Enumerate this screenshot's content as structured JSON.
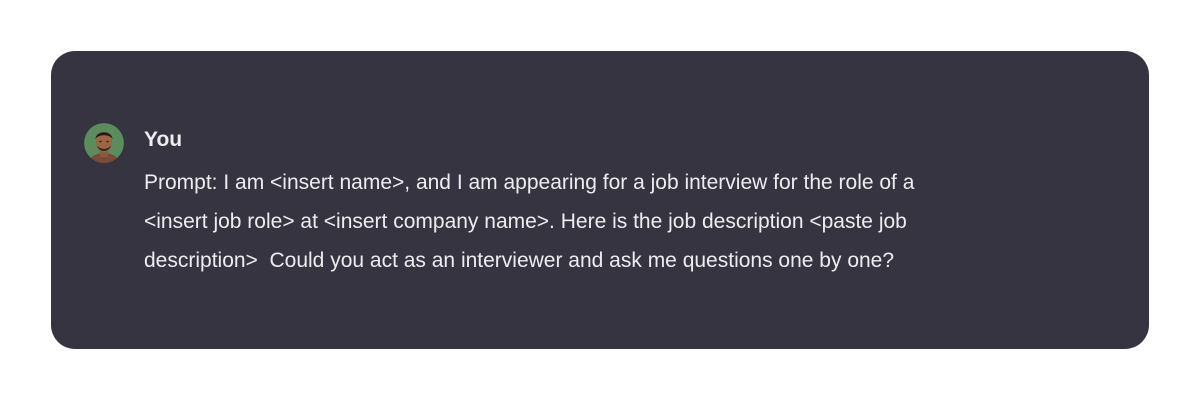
{
  "message": {
    "sender": "You",
    "avatar_icon": "user-avatar-photo",
    "lines": [
      "Prompt: I am <insert name>, and I am appearing for a job interview for the role of a",
      "<insert job role> at <insert company name>. Here is the job description <paste job",
      "description>  Could you act as an interviewer and ask me questions one by one?"
    ]
  },
  "colors": {
    "page_background": "#ffffff",
    "card_background": "#353440",
    "text": "#ececf1"
  }
}
